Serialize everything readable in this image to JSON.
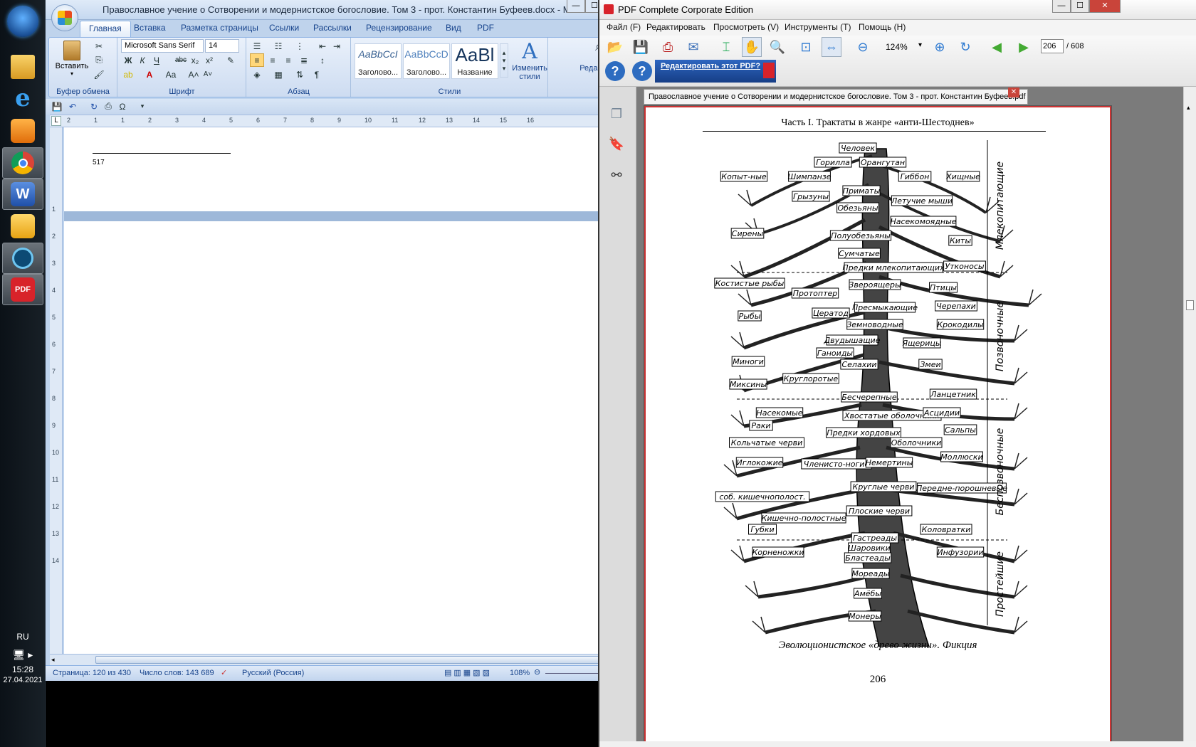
{
  "taskbar": {
    "language": "RU",
    "time": "15:28",
    "date": "27.04.2021",
    "apps": [
      {
        "name": "explorer-icon"
      },
      {
        "name": "internet-explorer-icon"
      },
      {
        "name": "media-player-icon"
      },
      {
        "name": "chrome-icon"
      },
      {
        "name": "word-icon"
      },
      {
        "name": "outlook-icon"
      },
      {
        "name": "kaspersky-icon"
      },
      {
        "name": "pdf-complete-icon",
        "label": "PDF"
      }
    ]
  },
  "word": {
    "title": "Православное учение о Сотворении и модернистское богословие. Том 3 - прот. Константин Буфеев.docx - Microsoft W...",
    "tabs": [
      "Главная",
      "Вставка",
      "Разметка страницы",
      "Ссылки",
      "Рассылки",
      "Рецензирование",
      "Вид",
      "PDF"
    ],
    "selected_tab": "Главная",
    "groups": {
      "clipboard": {
        "label": "Буфер обмена",
        "paste": "Вставить"
      },
      "font": {
        "label": "Шрифт",
        "font_name": "Microsoft Sans Serif",
        "font_size": "14"
      },
      "paragraph": {
        "label": "Абзац"
      },
      "styles": {
        "label": "Стили",
        "items": [
          {
            "preview": "AaBbCcI",
            "name": "Заголово..."
          },
          {
            "preview": "AaBbCcD",
            "name": "Заголово..."
          },
          {
            "preview": "AaBl",
            "name": "Название"
          }
        ],
        "change_styles": "Изменить стили"
      },
      "editing": {
        "label": "Редактиро"
      }
    },
    "footnote_number": "517",
    "ruler_numbers": [
      "2",
      "1",
      "1",
      "2",
      "3",
      "4",
      "5",
      "6",
      "7",
      "8",
      "9",
      "10",
      "11",
      "12",
      "13",
      "14",
      "15",
      "16"
    ],
    "vruler_numbers": [
      "1",
      "2",
      "3",
      "4",
      "5",
      "6",
      "7",
      "8",
      "9",
      "10",
      "11",
      "12",
      "13",
      "14"
    ],
    "status": {
      "page": "Страница: 120 из 430",
      "words": "Число слов: 143 689",
      "language": "Русский (Россия)",
      "zoom": "108%"
    }
  },
  "pdf": {
    "title": "PDF Complete Corporate Edition",
    "menu": [
      "Файл (F)",
      "Редактировать",
      "Просмотреть (V)",
      "Инструменты (T)",
      "Помощь (H)"
    ],
    "zoom": "124%",
    "page_current": "206",
    "page_total": "/ 608",
    "edit_banner": "Редактировать этот PDF?",
    "doc_tab": "Православное учение о Сотворении и модернистское богословие. Том 3 - прот. Константин Буфеев.pdf",
    "page": {
      "header": "Часть I. Трактаты в жанре «анти-Шестоднев»",
      "caption": "Эволюционистское «древо жизни». Фикция",
      "page_number": "206",
      "sections": [
        "Млекопитающие",
        "Позвоночные",
        "Беспозвоночные",
        "Простейшие"
      ],
      "labels": [
        "Человек",
        "Горилла",
        "Орангутан",
        "Копыт-ные",
        "Шимпанзе",
        "Гиббон",
        "Хищные",
        "Грызуны",
        "Приматы",
        "Обезьяны",
        "Летучие мыши",
        "Насекомоядные",
        "Сирены",
        "Полуобезьяны",
        "Киты",
        "Сумчатые",
        "Предки млекопитающих",
        "Утконосы",
        "Костистые рыбы",
        "Звероящеры",
        "Птицы",
        "Протоптер",
        "Цератод",
        "Пресмыкающие",
        "Черепахи",
        "Рыбы",
        "Земноводные",
        "Крокодилы",
        "Двудышащие",
        "Ящерицы",
        "Ганоиды",
        "Миноги",
        "Селахии",
        "Змеи",
        "Миксины",
        "Круглоротые",
        "Ланцетник",
        "Бесчерепные",
        "Насекомые",
        "Хвостатые оболочники",
        "Асцидии",
        "Раки",
        "Сальпы",
        "Предки хордовых",
        "Кольчатые черви",
        "Оболочники",
        "Членисто-ногие",
        "Иглокожие",
        "Немертины",
        "Моллюски",
        "Круглые черви",
        "Передне-порошневые",
        "соб. кишечнополост.",
        "Плоские черви",
        "Кишечно-полостные",
        "Губки",
        "Коловратки",
        "Гастреады",
        "Корненожки",
        "Шаровики",
        "Инфузории",
        "Бластеады",
        "Мореады",
        "Амёбы",
        "Монеры"
      ]
    }
  }
}
